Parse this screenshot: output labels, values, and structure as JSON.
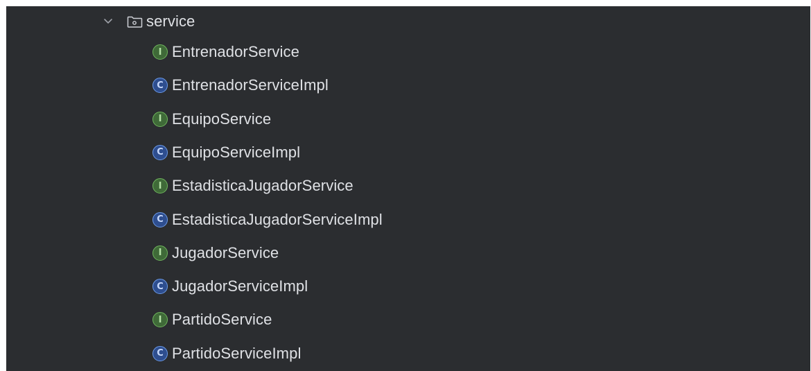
{
  "tree": {
    "folder": {
      "name": "service",
      "expanded": true,
      "icon": "folder-package-icon",
      "chevron_icon": "chevron-down-icon"
    },
    "items": [
      {
        "kind": "interface",
        "icon": "interface-icon",
        "badge_letter": "I",
        "label": "EntrenadorService"
      },
      {
        "kind": "class",
        "icon": "class-icon",
        "badge_letter": "C",
        "label": "EntrenadorServiceImpl"
      },
      {
        "kind": "interface",
        "icon": "interface-icon",
        "badge_letter": "I",
        "label": "EquipoService"
      },
      {
        "kind": "class",
        "icon": "class-icon",
        "badge_letter": "C",
        "label": "EquipoServiceImpl"
      },
      {
        "kind": "interface",
        "icon": "interface-icon",
        "badge_letter": "I",
        "label": "EstadisticaJugadorService"
      },
      {
        "kind": "class",
        "icon": "class-icon",
        "badge_letter": "C",
        "label": "EstadisticaJugadorServiceImpl"
      },
      {
        "kind": "interface",
        "icon": "interface-icon",
        "badge_letter": "I",
        "label": "JugadorService"
      },
      {
        "kind": "class",
        "icon": "class-icon",
        "badge_letter": "C",
        "label": "JugadorServiceImpl"
      },
      {
        "kind": "interface",
        "icon": "interface-icon",
        "badge_letter": "I",
        "label": "PartidoService"
      },
      {
        "kind": "class",
        "icon": "class-icon",
        "badge_letter": "C",
        "label": "PartidoServiceImpl"
      }
    ]
  },
  "colors": {
    "background": "#2b2d30",
    "text": "#dfe1e5",
    "interface_badge": "#6fb65d",
    "class_badge": "#6c9be8"
  }
}
